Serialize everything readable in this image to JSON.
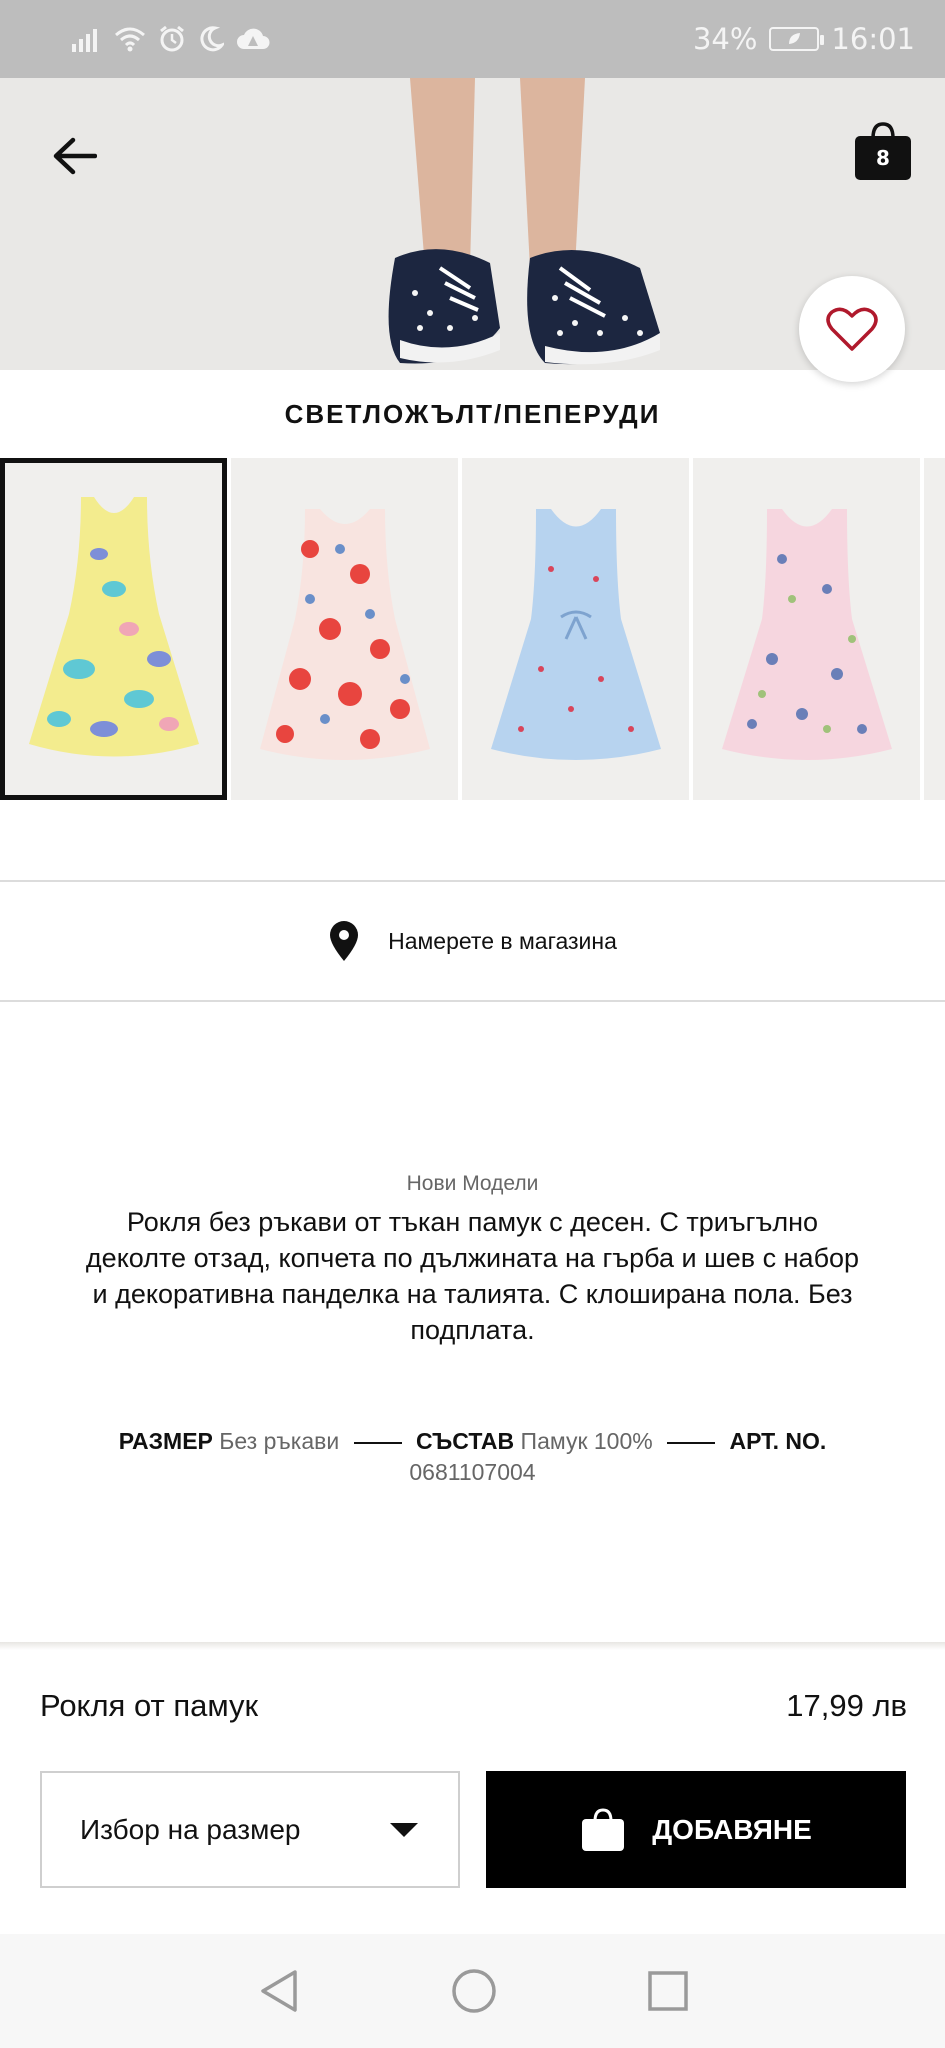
{
  "status_bar": {
    "battery_percent": "34%",
    "time": "16:01"
  },
  "header": {
    "cart_count": "8"
  },
  "product": {
    "color_name": "СВЕТЛОЖЪЛТ/ПЕПЕРУДИ",
    "thumbnails": [
      {
        "name": "yellow-butterfly-dress",
        "color": "#f3ec8e",
        "selected": true
      },
      {
        "name": "red-floral-dress",
        "color": "#e8645a",
        "selected": false
      },
      {
        "name": "blue-striped-dress",
        "color": "#b7d3ef",
        "selected": false
      },
      {
        "name": "pink-print-dress",
        "color": "#f6d6df",
        "selected": false
      }
    ],
    "store_finder_label": "Намерете в магазина",
    "category": "Нови Модели",
    "description": "Рокля без ръкави от тъкан памук с десен. С триъгълно деколте отзад, копчета по дължината на гърба и шев с набор и декоративна панделка на талията. С клоширана пола. Без подплата.",
    "attributes": {
      "size_label": "РАЗМЕР",
      "size_value": "Без ръкави",
      "composition_label": "СЪСТАВ",
      "composition_value": "Памук 100%",
      "art_label": "АРТ. NO.",
      "art_value": "0681107004"
    },
    "name": "Рокля от памук",
    "price": "17,99 лв"
  },
  "actions": {
    "size_select_label": "Избор на размер",
    "add_button_label": "ДОБАВЯНЕ"
  },
  "colors": {
    "status_bar_bg": "#bdbdbd",
    "primary_button": "#000000",
    "heart": "#b0192c"
  }
}
